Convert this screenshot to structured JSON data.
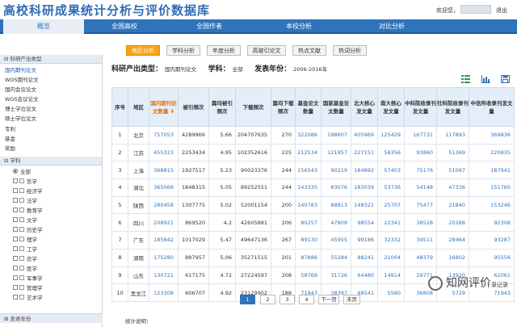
{
  "header": {
    "logo": "高校科研成果统计分析与评价数据库",
    "welcome": "欢迎您，",
    "exit": "退出"
  },
  "nav": [
    {
      "label": "概览",
      "active": true
    },
    {
      "label": "全国高校",
      "active": false
    },
    {
      "label": "全国作者",
      "active": false
    },
    {
      "label": "本校分析",
      "active": false
    },
    {
      "label": "对比分析",
      "active": false
    }
  ],
  "tabs": [
    {
      "label": "地区分析",
      "active": true
    },
    {
      "label": "学科分析",
      "active": false
    },
    {
      "label": "年度分析",
      "active": false
    },
    {
      "label": "高被引论文",
      "active": false
    },
    {
      "label": "热点文献",
      "active": false
    },
    {
      "label": "热词分析",
      "active": false
    }
  ],
  "filter": {
    "type_label": "科研产出类型：",
    "type_value": "国内期刊论文",
    "subject_label": "学科：",
    "subject_value": "全部",
    "year_label": "发表年份：",
    "year_value": "2006-2016年"
  },
  "sidebar": {
    "output_head": "科研产出类型",
    "output_items": [
      "国内期刊论文",
      "WOS期刊论文",
      "国内会议论文",
      "WOS会议论文",
      "博士学位论文",
      "硕士学位论文",
      "专利",
      "基金",
      "奖励"
    ],
    "subject_head": "学科",
    "subject_items": [
      "全部",
      "哲学",
      "经济学",
      "法学",
      "教育学",
      "文学",
      "历史学",
      "理学",
      "工学",
      "农学",
      "医学",
      "军事学",
      "管理学",
      "艺术学"
    ],
    "footer": "发表年份"
  },
  "table": {
    "headers": [
      "序号",
      "地区",
      "国内期刊论文数量",
      "被引频次",
      "篇均被引频次",
      "下载频次",
      "篇均下载频次",
      "基金论文数量",
      "国家基金论文数量",
      "北大核心发文量",
      "南大核心发文量",
      "中科院收录刊发文量",
      "社科院收录刊发文量",
      "中信所收录刊发文量"
    ],
    "rows": [
      [
        "1",
        "北京",
        "757053",
        "4289966",
        "5.66",
        "204707635",
        "270",
        "322086",
        "198607",
        "405969",
        "125429",
        "167731",
        "117893",
        "369836"
      ],
      [
        "2",
        "江苏",
        "455323",
        "2253434",
        "4.95",
        "102352616",
        "225",
        "212534",
        "121857",
        "227151",
        "58356",
        "93860",
        "51369",
        "220835"
      ],
      [
        "3",
        "上海",
        "368815",
        "1927517",
        "5.23",
        "90023376",
        "244",
        "156543",
        "90219",
        "184892",
        "57403",
        "75176",
        "51067",
        "187941"
      ],
      [
        "4",
        "湖北",
        "365068",
        "1848315",
        "5.05",
        "89252551",
        "244",
        "143335",
        "83076",
        "183039",
        "53736",
        "54148",
        "47336",
        "151760"
      ],
      [
        "5",
        "陕西",
        "280458",
        "1307775",
        "5.02",
        "52001154",
        "200",
        "140783",
        "88813",
        "148321",
        "25707",
        "75477",
        "21840",
        "153246"
      ],
      [
        "6",
        "四川",
        "208921",
        "869520",
        "4.2",
        "42605881",
        "206",
        "80257",
        "47809",
        "98554",
        "22341",
        "38528",
        "20288",
        "92308"
      ],
      [
        "7",
        "广东",
        "185842",
        "1017029",
        "5.47",
        "49647136",
        "267",
        "89130",
        "45955",
        "99186",
        "32332",
        "34511",
        "28464",
        "93287"
      ],
      [
        "8",
        "湖南",
        "175280",
        "887957",
        "5.06",
        "35271515",
        "201",
        "87886",
        "55284",
        "88241",
        "21004",
        "48379",
        "16802",
        "95556"
      ],
      [
        "9",
        "山东",
        "130721",
        "617175",
        "4.72",
        "27224597",
        "208",
        "58769",
        "31726",
        "64480",
        "14914",
        "29771",
        "13920",
        "62061"
      ],
      [
        "10",
        "黑龙江",
        "123308",
        "606707",
        "4.92",
        "23129902",
        "188",
        "71943",
        "38397",
        "68541",
        "5560",
        "36808",
        "5729",
        "71943"
      ]
    ]
  },
  "pager": {
    "pages": [
      "1",
      "2",
      "3",
      "4"
    ],
    "next": "下一页",
    "last": "末页"
  },
  "stat_note": "统计说明：",
  "watermark": {
    "text": "知网评价",
    "suffix": "录记录"
  },
  "colors": {
    "nav": "#2f73bb",
    "tab_active": "#f7a21b",
    "header_cell": "#e3eef9"
  }
}
